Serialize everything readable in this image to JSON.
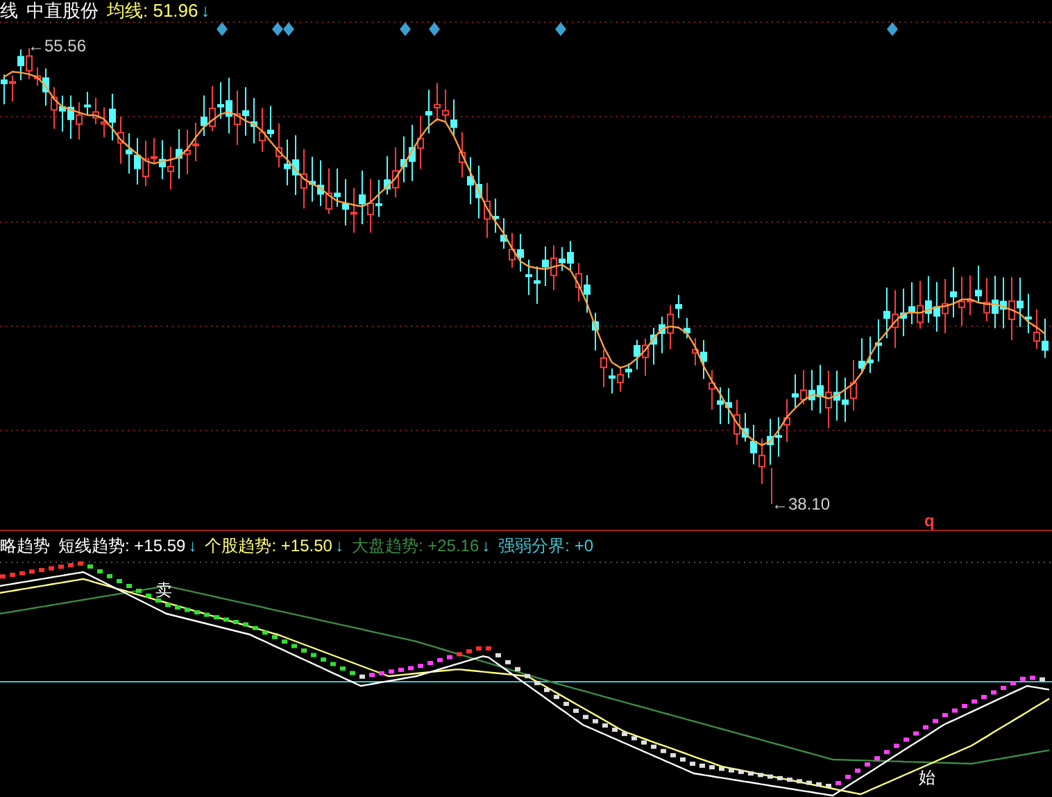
{
  "header": {
    "indicator_fragment": "线",
    "stock_name": "中直股份",
    "ma_label": "均线: 51.96",
    "ma_arrow": "↓"
  },
  "price_chart": {
    "high_label": "←55.56",
    "low_label": "←38.10",
    "marker": "q"
  },
  "indicator_panel": {
    "name_fragment": "略趋势",
    "items": [
      {
        "label": "短线趋势: +15.59",
        "arrow": "↓",
        "color": "#ffffff"
      },
      {
        "label": "个股趋势: +15.50",
        "arrow": "↓",
        "color": "#ffff80"
      },
      {
        "label": "大盘趋势: +25.16",
        "arrow": "↓",
        "color": "#3c8c46"
      },
      {
        "label": "强弱分界: +0",
        "color": "#40c8d8"
      }
    ],
    "signals": [
      "卖",
      "始"
    ]
  }
}
